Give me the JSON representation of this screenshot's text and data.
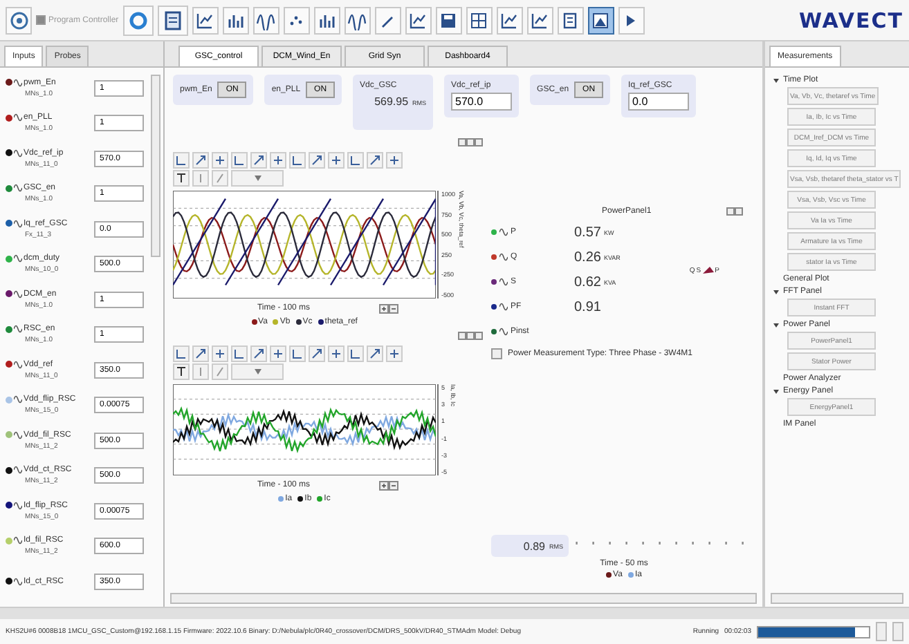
{
  "toolbar": {
    "program_controller": {
      "label": "Program Controller",
      "checked": true
    }
  },
  "logo": "WAVECT",
  "left_tabs": [
    {
      "label": "Inputs",
      "selected": true
    },
    {
      "label": "Probes",
      "selected": false
    }
  ],
  "inputs": [
    {
      "name": "pwm_En",
      "sub": "MNs_1.0",
      "value": "1",
      "color": "#6b1a1a"
    },
    {
      "name": "en_PLL",
      "sub": "MNs_1.0",
      "value": "1",
      "color": "#b01e1e"
    },
    {
      "name": "Vdc_ref_ip",
      "sub": "MNs_11_0",
      "value": "570.0",
      "color": "#111111"
    },
    {
      "name": "GSC_en",
      "sub": "MNs_1.0",
      "value": "1",
      "color": "#1f8a3c"
    },
    {
      "name": "Iq_ref_GSC",
      "sub": "Fx_11_3",
      "value": "0.0",
      "color": "#1d5fa8"
    },
    {
      "name": "dcm_duty",
      "sub": "MNs_10_0",
      "value": "500.0",
      "color": "#2fb34a"
    },
    {
      "name": "DCM_en",
      "sub": "MNs_1.0",
      "value": "1",
      "color": "#6a1a6a"
    },
    {
      "name": "RSC_en",
      "sub": "MNs_1.0",
      "value": "1",
      "color": "#1f8a3c"
    },
    {
      "name": "Vdd_ref",
      "sub": "MNs_11_0",
      "value": "350.0",
      "color": "#b01e1e"
    },
    {
      "name": "Vdd_flip_RSC",
      "sub": "MNs_15_0",
      "value": "0.00075",
      "color": "#a9c4e6"
    },
    {
      "name": "Vdd_fil_RSC",
      "sub": "MNs_11_2",
      "value": "500.0",
      "color": "#9fc27a"
    },
    {
      "name": "Vdd_ct_RSC",
      "sub": "MNs_11_2",
      "value": "500.0",
      "color": "#111111"
    },
    {
      "name": "Id_flip_RSC",
      "sub": "MNs_15_0",
      "value": "0.00075",
      "color": "#14147a"
    },
    {
      "name": "Id_fil_RSC",
      "sub": "MNs_11_2",
      "value": "600.0",
      "color": "#b5cf6a"
    },
    {
      "name": "Id_ct_RSC",
      "value": "350.0",
      "color": "#111111"
    }
  ],
  "center_tabs": [
    {
      "label": "GSC_control",
      "selected": true
    },
    {
      "label": "DCM_Wind_En",
      "selected": false
    },
    {
      "label": "Grid Syn",
      "selected": false
    },
    {
      "label": "Dashboard4",
      "selected": false
    }
  ],
  "widgets": [
    {
      "kind": "toggle",
      "label": "pwm_En",
      "button": "ON"
    },
    {
      "kind": "toggle",
      "label": "en_PLL",
      "button": "ON"
    },
    {
      "kind": "display",
      "label": "Vdc_GSC",
      "value": "569.95",
      "unit": "RMS"
    },
    {
      "kind": "input",
      "label": "Vdc_ref_ip",
      "value": "570.0"
    },
    {
      "kind": "toggle",
      "label": "GSC_en",
      "button": "ON"
    },
    {
      "kind": "input",
      "label": "Iq_ref_GSC",
      "value": "0.0"
    }
  ],
  "scopes": [
    {
      "kind": "voltage",
      "ylabel": "Va, Vb, Vc, theta_ref",
      "yticks": [
        "1000",
        "750",
        "500",
        "250",
        "-250",
        "-500"
      ],
      "xlabel": "Time - 100 ms",
      "legend": [
        {
          "label": "Va",
          "color": "#8b1a1a"
        },
        {
          "label": "Vb",
          "color": "#b5b52a"
        },
        {
          "label": "Vc",
          "color": "#2a2a3a"
        },
        {
          "label": "theta_ref",
          "color": "#1a1a6b"
        }
      ]
    },
    {
      "kind": "current",
      "ylabel": "Ia, Ib, Ic",
      "yticks": [
        "5",
        "3",
        "1",
        "-1",
        "-3",
        "-5"
      ],
      "xlabel": "Time - 100 ms",
      "legend": [
        {
          "label": "Ia",
          "color": "#7fa8e0"
        },
        {
          "label": "Ib",
          "color": "#111111"
        },
        {
          "label": "Ic",
          "color": "#22a52a"
        }
      ]
    }
  ],
  "power_panel": {
    "title": "PowerPanel1",
    "rows": [
      {
        "label": "P",
        "value": "0.57",
        "unit": "KW",
        "color": "#2db34a"
      },
      {
        "label": "Q",
        "value": "0.26",
        "unit": "KVAR",
        "color": "#c0392b"
      },
      {
        "label": "S",
        "value": "0.62",
        "unit": "KVA",
        "color": "#6a2a7a"
      },
      {
        "label": "PF",
        "value": "0.91",
        "unit": "",
        "color": "#1a2a8b"
      },
      {
        "label": "Pinst",
        "value": "",
        "unit": "",
        "color": "#1f6b3c"
      }
    ],
    "phasor": [
      "Q",
      "S",
      "P"
    ],
    "type_note": "Power Measurement Type: Three Phase - 3W4M1"
  },
  "rms_display": {
    "value": "0.89",
    "unit": "RMS"
  },
  "bottom_plot": {
    "xlabel": "Time - 50 ms",
    "legend": [
      {
        "label": "Va",
        "color": "#6b1a1a"
      },
      {
        "label": "Ia",
        "color": "#7fa8e0"
      }
    ]
  },
  "right_tab": "Measurements",
  "tree": [
    {
      "label": "Time Plot",
      "expanded": true,
      "children": [
        "Va, Vb, Vc, thetaref vs Time",
        "Ia, Ib, Ic vs Time",
        "DCM_Iref_DCM vs Time",
        "Iq, Id, Iq vs Time",
        "Vsa, Vsb, thetaref theta_stator vs T",
        "Vsa, Vsb, Vsc vs Time",
        "Va Ia vs Time",
        "Armature Ia vs Time",
        "stator Ia vs Time"
      ]
    },
    {
      "label": "General Plot"
    },
    {
      "label": "FFT Panel",
      "expanded": true,
      "children": [
        "Instant FFT"
      ]
    },
    {
      "label": "Power Panel",
      "expanded": true,
      "children": [
        "PowerPanel1",
        "Stator Power"
      ]
    },
    {
      "label": "Power Analyzer"
    },
    {
      "label": "Energy Panel",
      "expanded": true,
      "children": [
        "EnergyPanel1"
      ]
    },
    {
      "label": "IM Panel"
    }
  ],
  "status": {
    "text": "KHS2U#6 0008B18 1MCU_GSC_Custom@192.168.1.15 Firmware: 2022.10.6 Binary: D:/Nebula/plc/0R40_crossover/DCM/DRS_500kV/DR40_STMAdm Model: Debug",
    "state": "Running",
    "time": "00:02:03",
    "level": 0.88
  }
}
